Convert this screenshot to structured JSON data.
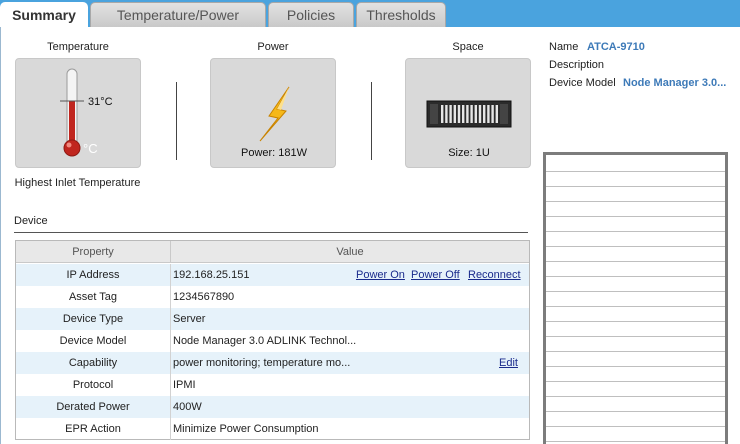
{
  "tabs": [
    {
      "label": "Summary",
      "active": true
    },
    {
      "label": "Temperature/Power",
      "active": false
    },
    {
      "label": "Policies",
      "active": false
    },
    {
      "label": "Thresholds",
      "active": false
    }
  ],
  "cards": {
    "temperature": {
      "title": "Temperature",
      "reading": "31°C",
      "unit_mark": "°C",
      "caption": "Highest Inlet Temperature",
      "icon": "thermometer-icon"
    },
    "power": {
      "title": "Power",
      "caption": "Power: 181W",
      "icon": "lightning-bolt-icon"
    },
    "space": {
      "title": "Space",
      "caption": "Size: 1U",
      "icon": "server-chassis-icon"
    }
  },
  "device": {
    "section_label": "Device",
    "headers": {
      "property": "Property",
      "value": "Value"
    },
    "rows": [
      {
        "property": "IP Address",
        "value": "192.168.25.151"
      },
      {
        "property": "Asset Tag",
        "value": "1234567890"
      },
      {
        "property": "Device Type",
        "value": "Server"
      },
      {
        "property": "Device Model",
        "value": "Node Manager 3.0 ADLINK Technol..."
      },
      {
        "property": "Capability",
        "value": "power monitoring; temperature mo..."
      },
      {
        "property": "Protocol",
        "value": "IPMI"
      },
      {
        "property": "Derated Power",
        "value": "400W"
      },
      {
        "property": "EPR Action",
        "value": "Minimize Power Consumption"
      }
    ],
    "actions": {
      "power_on": "Power On",
      "power_off": "Power Off",
      "reconnect": "Reconnect",
      "edit": "Edit"
    }
  },
  "info": {
    "name_label": "Name",
    "name_value": "ATCA-9710",
    "description_label": "Description",
    "description_value": "",
    "model_label": "Device Model",
    "model_value": "Node Manager 3.0..."
  },
  "colors": {
    "tabbar": "#4aa3de",
    "link": "#1a2b8c",
    "info_value": "#3d7ab8",
    "row_alt": "#e6f2fa"
  }
}
